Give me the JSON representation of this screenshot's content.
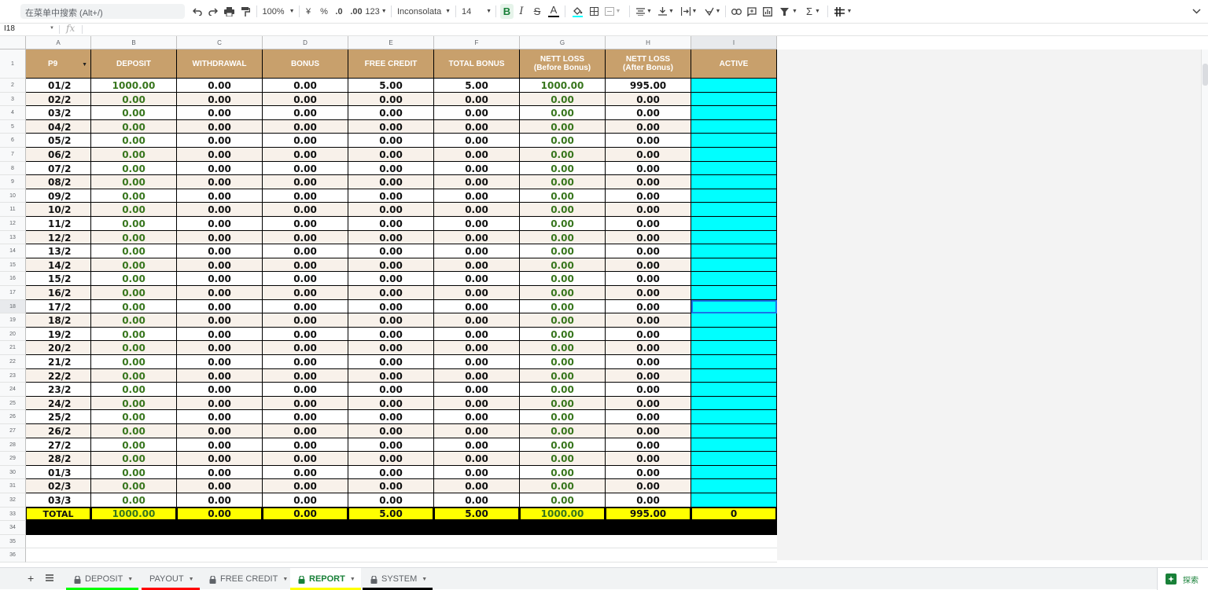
{
  "toolbar": {
    "menu_search": "在菜单中搜索 (Alt+/)",
    "zoom": "100%",
    "currency": "¥",
    "percent": "%",
    "dec_less": ".0",
    "dec_more": ".00",
    "format_more": "123",
    "font": "Inconsolata",
    "font_size": "14",
    "bold": "B",
    "italic": "I",
    "strike": "S",
    "text_color": "A",
    "sum": "Σ"
  },
  "formula_bar": {
    "name_box": "I18",
    "fx": "fx",
    "value": ""
  },
  "columns": [
    "A",
    "B",
    "C",
    "D",
    "E",
    "F",
    "G",
    "H",
    "I"
  ],
  "headers": [
    "P9",
    "DEPOSIT",
    "WITHDRAWAL",
    "BONUS",
    "FREE CREDIT",
    "TOTAL BONUS",
    "NETT LOSS (Before Bonus)",
    "NETT LOSS (After Bonus)",
    "ACTIVE"
  ],
  "rows": [
    [
      "01/2",
      "1000.00",
      "0.00",
      "0.00",
      "5.00",
      "5.00",
      "1000.00",
      "995.00",
      ""
    ],
    [
      "02/2",
      "0.00",
      "0.00",
      "0.00",
      "0.00",
      "0.00",
      "0.00",
      "0.00",
      ""
    ],
    [
      "03/2",
      "0.00",
      "0.00",
      "0.00",
      "0.00",
      "0.00",
      "0.00",
      "0.00",
      ""
    ],
    [
      "04/2",
      "0.00",
      "0.00",
      "0.00",
      "0.00",
      "0.00",
      "0.00",
      "0.00",
      ""
    ],
    [
      "05/2",
      "0.00",
      "0.00",
      "0.00",
      "0.00",
      "0.00",
      "0.00",
      "0.00",
      ""
    ],
    [
      "06/2",
      "0.00",
      "0.00",
      "0.00",
      "0.00",
      "0.00",
      "0.00",
      "0.00",
      ""
    ],
    [
      "07/2",
      "0.00",
      "0.00",
      "0.00",
      "0.00",
      "0.00",
      "0.00",
      "0.00",
      ""
    ],
    [
      "08/2",
      "0.00",
      "0.00",
      "0.00",
      "0.00",
      "0.00",
      "0.00",
      "0.00",
      ""
    ],
    [
      "09/2",
      "0.00",
      "0.00",
      "0.00",
      "0.00",
      "0.00",
      "0.00",
      "0.00",
      ""
    ],
    [
      "10/2",
      "0.00",
      "0.00",
      "0.00",
      "0.00",
      "0.00",
      "0.00",
      "0.00",
      ""
    ],
    [
      "11/2",
      "0.00",
      "0.00",
      "0.00",
      "0.00",
      "0.00",
      "0.00",
      "0.00",
      ""
    ],
    [
      "12/2",
      "0.00",
      "0.00",
      "0.00",
      "0.00",
      "0.00",
      "0.00",
      "0.00",
      ""
    ],
    [
      "13/2",
      "0.00",
      "0.00",
      "0.00",
      "0.00",
      "0.00",
      "0.00",
      "0.00",
      ""
    ],
    [
      "14/2",
      "0.00",
      "0.00",
      "0.00",
      "0.00",
      "0.00",
      "0.00",
      "0.00",
      ""
    ],
    [
      "15/2",
      "0.00",
      "0.00",
      "0.00",
      "0.00",
      "0.00",
      "0.00",
      "0.00",
      ""
    ],
    [
      "16/2",
      "0.00",
      "0.00",
      "0.00",
      "0.00",
      "0.00",
      "0.00",
      "0.00",
      ""
    ],
    [
      "17/2",
      "0.00",
      "0.00",
      "0.00",
      "0.00",
      "0.00",
      "0.00",
      "0.00",
      ""
    ],
    [
      "18/2",
      "0.00",
      "0.00",
      "0.00",
      "0.00",
      "0.00",
      "0.00",
      "0.00",
      ""
    ],
    [
      "19/2",
      "0.00",
      "0.00",
      "0.00",
      "0.00",
      "0.00",
      "0.00",
      "0.00",
      ""
    ],
    [
      "20/2",
      "0.00",
      "0.00",
      "0.00",
      "0.00",
      "0.00",
      "0.00",
      "0.00",
      ""
    ],
    [
      "21/2",
      "0.00",
      "0.00",
      "0.00",
      "0.00",
      "0.00",
      "0.00",
      "0.00",
      ""
    ],
    [
      "22/2",
      "0.00",
      "0.00",
      "0.00",
      "0.00",
      "0.00",
      "0.00",
      "0.00",
      ""
    ],
    [
      "23/2",
      "0.00",
      "0.00",
      "0.00",
      "0.00",
      "0.00",
      "0.00",
      "0.00",
      ""
    ],
    [
      "24/2",
      "0.00",
      "0.00",
      "0.00",
      "0.00",
      "0.00",
      "0.00",
      "0.00",
      ""
    ],
    [
      "25/2",
      "0.00",
      "0.00",
      "0.00",
      "0.00",
      "0.00",
      "0.00",
      "0.00",
      ""
    ],
    [
      "26/2",
      "0.00",
      "0.00",
      "0.00",
      "0.00",
      "0.00",
      "0.00",
      "0.00",
      ""
    ],
    [
      "27/2",
      "0.00",
      "0.00",
      "0.00",
      "0.00",
      "0.00",
      "0.00",
      "0.00",
      ""
    ],
    [
      "28/2",
      "0.00",
      "0.00",
      "0.00",
      "0.00",
      "0.00",
      "0.00",
      "0.00",
      ""
    ],
    [
      "01/3",
      "0.00",
      "0.00",
      "0.00",
      "0.00",
      "0.00",
      "0.00",
      "0.00",
      ""
    ],
    [
      "02/3",
      "0.00",
      "0.00",
      "0.00",
      "0.00",
      "0.00",
      "0.00",
      "0.00",
      ""
    ],
    [
      "03/3",
      "0.00",
      "0.00",
      "0.00",
      "0.00",
      "0.00",
      "0.00",
      "0.00",
      ""
    ]
  ],
  "total_row": [
    "TOTAL",
    "1000.00",
    "0.00",
    "0.00",
    "5.00",
    "5.00",
    "1000.00",
    "995.00",
    "0"
  ],
  "row_numbers": [
    "1",
    "2",
    "3",
    "4",
    "5",
    "6",
    "7",
    "8",
    "9",
    "10",
    "11",
    "12",
    "13",
    "14",
    "15",
    "16",
    "17",
    "18",
    "19",
    "20",
    "21",
    "22",
    "23",
    "24",
    "25",
    "26",
    "27",
    "28",
    "29",
    "30",
    "31",
    "32",
    "33",
    "34",
    "35",
    "36"
  ],
  "selected_cell": "I18",
  "colors": {
    "header_bg": "#c8a06c",
    "band_bg": "#f8f1ea",
    "active_bg": "#00ffff",
    "total_bg": "#ffff00",
    "value_green": "#38761d"
  },
  "sheet_tabs": [
    {
      "label": "DEPOSIT",
      "locked": true,
      "color": "#00ff00",
      "active": false
    },
    {
      "label": "PAYOUT",
      "locked": false,
      "color": "#ff0000",
      "active": false
    },
    {
      "label": "FREE CREDIT",
      "locked": true,
      "color": "",
      "active": false
    },
    {
      "label": "REPORT",
      "locked": true,
      "color": "#ffff00",
      "active": true
    },
    {
      "label": "SYSTEM",
      "locked": true,
      "color": "#000000",
      "active": false
    }
  ],
  "explore_label": "探索"
}
